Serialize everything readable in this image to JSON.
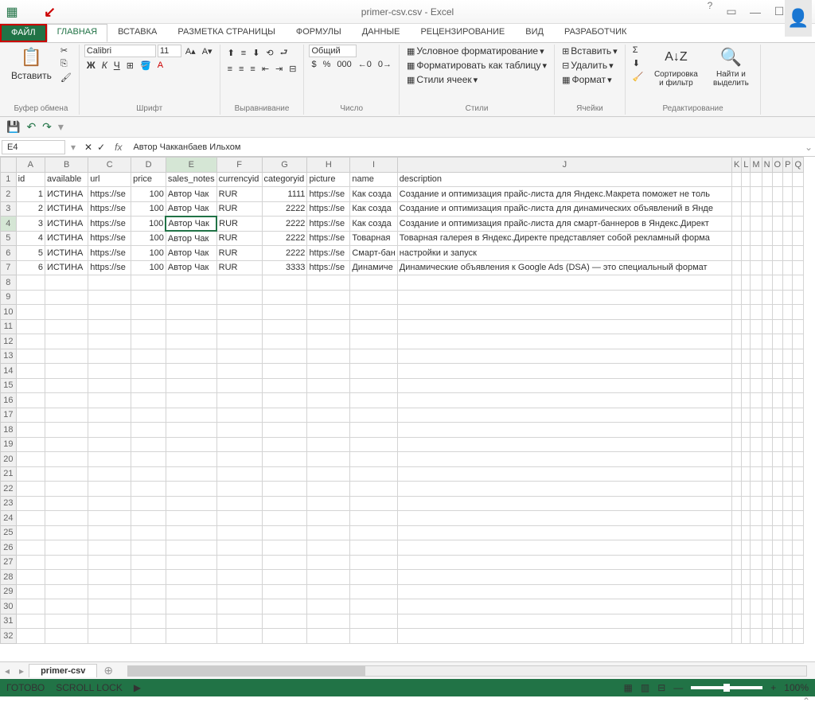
{
  "title": "primer-csv.csv - Excel",
  "tabs": {
    "file": "ФАЙЛ",
    "home": "ГЛАВНАЯ",
    "insert": "ВСТАВКА",
    "layout": "РАЗМЕТКА СТРАНИЦЫ",
    "formulas": "ФОРМУЛЫ",
    "data": "ДАННЫЕ",
    "review": "РЕЦЕНЗИРОВАНИЕ",
    "view": "ВИД",
    "developer": "РАЗРАБОТЧИК"
  },
  "ribbon": {
    "clipboard": {
      "paste": "Вставить",
      "label": "Буфер обмена"
    },
    "font": {
      "name": "Calibri",
      "size": "11",
      "label": "Шрифт"
    },
    "align": {
      "label": "Выравнивание"
    },
    "number": {
      "format": "Общий",
      "label": "Число"
    },
    "styles": {
      "cond": "Условное форматирование",
      "table": "Форматировать как таблицу",
      "cell": "Стили ячеек",
      "label": "Стили"
    },
    "cells": {
      "insert": "Вставить",
      "delete": "Удалить",
      "format": "Формат",
      "label": "Ячейки"
    },
    "editing": {
      "sort": "Сортировка и фильтр",
      "find": "Найти и выделить",
      "label": "Редактирование"
    }
  },
  "nameBox": "E4",
  "formula": "Автор Чакканбаев Ильхом",
  "columns": [
    "A",
    "B",
    "C",
    "D",
    "E",
    "F",
    "G",
    "H",
    "I",
    "J",
    "K",
    "L",
    "M",
    "N",
    "O",
    "P",
    "Q"
  ],
  "headers": [
    "id",
    "available",
    "url",
    "price",
    "sales_notes",
    "currencyid",
    "categoryid",
    "picture",
    "name",
    "description"
  ],
  "rows": [
    {
      "n": "1",
      "d": [
        "id",
        "available",
        "url",
        "price",
        "sales_notes",
        "currencyid",
        "categoryid",
        "picture",
        "name",
        "description"
      ]
    },
    {
      "n": "2",
      "d": [
        "1",
        "ИСТИНА",
        "https://se",
        "100",
        "Автор Чак",
        "RUR",
        "1111",
        "https://se",
        "Как созда",
        "Создание и оптимизация прайс-листа для Яндекс.Макрета поможет не толь"
      ]
    },
    {
      "n": "3",
      "d": [
        "2",
        "ИСТИНА",
        "https://se",
        "100",
        "Автор Чак",
        "RUR",
        "2222",
        "https://se",
        "Как созда",
        "Создание и оптимизация прайс-листа для динамических объявлений в Янде"
      ]
    },
    {
      "n": "4",
      "d": [
        "3",
        "ИСТИНА",
        "https://se",
        "100",
        "Автор Чак",
        "RUR",
        "2222",
        "https://se",
        "Как созда",
        "Создание и оптимизация прайс-листа для смарт-баннеров в Яндекс.Директ"
      ]
    },
    {
      "n": "5",
      "d": [
        "4",
        "ИСТИНА",
        "https://se",
        "100",
        "Автор Чак",
        "RUR",
        "2222",
        "https://se",
        "Товарная",
        "Товарная галерея в Яндекс.Директе представляет собой рекламный форма"
      ]
    },
    {
      "n": "6",
      "d": [
        "5",
        "ИСТИНА",
        "https://se",
        "100",
        "Автор Чак",
        "RUR",
        "2222",
        "https://se",
        "Смарт-бан",
        "настройки и запуск"
      ]
    },
    {
      "n": "7",
      "d": [
        "6",
        "ИСТИНА",
        "https://se",
        "100",
        "Автор Чак",
        "RUR",
        "3333",
        "https://se",
        "Динамиче",
        "Динамические объявления к Google Ads (DSA) — это специальный формат"
      ]
    }
  ],
  "sheet": "primer-csv",
  "status": {
    "ready": "ГОТОВО",
    "scroll": "SCROLL LOCK",
    "zoom": "100%"
  }
}
